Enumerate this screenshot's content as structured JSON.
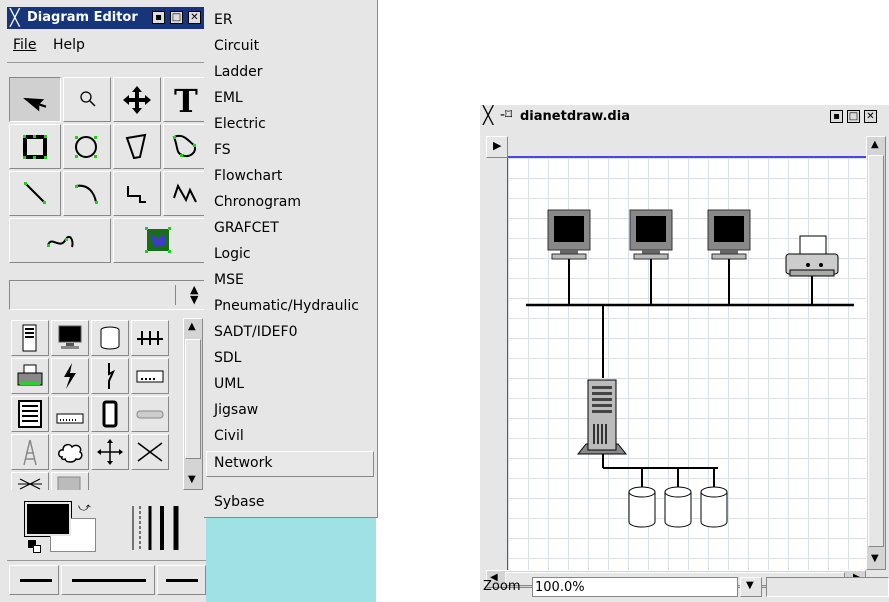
{
  "toolbox": {
    "title": "Diagram Editor",
    "menu": {
      "file": "File",
      "help": "Help"
    },
    "tools": [
      "pointer-tool",
      "magnify-tool",
      "move-tool",
      "text-tool",
      "box-tool",
      "ellipse-tool",
      "polygon-tool",
      "beziergon-tool",
      "line-tool",
      "arc-tool",
      "zigzag-tool",
      "polyline-tool",
      "bezier-tool",
      "image-tool"
    ],
    "sheet_selector_value": ""
  },
  "sheets_menu": {
    "items": [
      "ER",
      "Circuit",
      "Ladder",
      "EML",
      "Electric",
      "FS",
      "Flowchart",
      "Chronogram",
      "GRAFCET",
      "Logic",
      "MSE",
      "Pneumatic/Hydraulic",
      "SADT/IDEF0",
      "SDL",
      "UML",
      "Jigsaw",
      "Civil",
      "Network",
      "Sybase"
    ],
    "highlighted": "Network"
  },
  "diagram_window": {
    "title": "dianetdraw.dia",
    "zoom_label": "Zoom",
    "zoom_value": "100.0%"
  },
  "colors": {
    "titlebar": "#16357b",
    "canvas_grid": "#d8e0ea",
    "toolbox_bg": "#e6e6e6",
    "cyan_area": "#9fe1e4"
  }
}
